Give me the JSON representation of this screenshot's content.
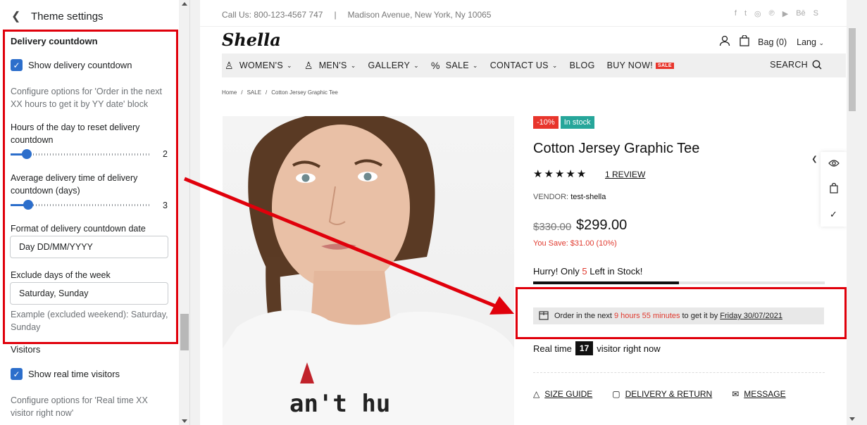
{
  "panel": {
    "title": "Theme settings",
    "delivery": {
      "section_title": "Delivery countdown",
      "show_label": "Show delivery countdown",
      "show_checked": true,
      "help": "Configure options for 'Order in the next XX hours to get it by YY date' block",
      "reset_label": "Hours of the day to reset delivery countdown",
      "reset_value": "2",
      "avg_label": "Average delivery time of delivery countdown (days)",
      "avg_value": "3",
      "format_label": "Format of delivery countdown date",
      "format_value": "Day DD/MM/YYYY",
      "exclude_label": "Exclude days of the week",
      "exclude_value": "Saturday, Sunday",
      "exclude_help": "Example (excluded weekend): Saturday, Sunday"
    },
    "visitors": {
      "section_title": "Visitors",
      "show_label": "Show real time visitors",
      "show_checked": true,
      "help": "Configure options for 'Real time XX visitor right now'"
    }
  },
  "store": {
    "call": "Call Us: 800-123-4567 747",
    "separator": "|",
    "address": "Madison Avenue, New York, Ny 10065",
    "social_icons": [
      "facebook-icon",
      "twitter-icon",
      "instagram-icon",
      "pinterest-icon",
      "youtube-icon",
      "behance-icon",
      "skype-icon"
    ],
    "social_glyphs": [
      "f",
      "t",
      "◎",
      "℗",
      "▶",
      "Bē",
      "S"
    ],
    "logo": "Shella",
    "bag": "Bag (0)",
    "lang": "Lang",
    "nav": [
      "WOMEN'S",
      "MEN'S",
      "GALLERY",
      "SALE",
      "CONTACT US",
      "BLOG",
      "BUY NOW!"
    ],
    "nav_sale_badge": "SALE",
    "search": "SEARCH",
    "breadcrumb": [
      "Home",
      "/",
      "SALE",
      "/",
      "Cotton Jersey Graphic Tee"
    ]
  },
  "product": {
    "discount": "-10%",
    "stock_badge": "In stock",
    "title": "Cotton Jersey Graphic Tee",
    "stars": "★★★★★",
    "rating": 5,
    "review": "1 REVIEW",
    "vendor_label": "VENDOR:",
    "vendor": "test-shella",
    "old_price": "$330.00",
    "price": "$299.00",
    "save": "You Save: $31.00 (10%)",
    "hurry_prefix": "Hurry! Only",
    "hurry_count": "5",
    "hurry_suffix": "Left in Stock!",
    "stock_fraction": 0.5,
    "delivery_prefix": "Order in the next",
    "delivery_time": "9 hours 55 minutes",
    "delivery_middle": "to get it by",
    "delivery_date": "Friday 30/07/2021",
    "realtime_prefix": "Real time",
    "realtime_count": "17",
    "realtime_suffix": "visitor right now",
    "links": [
      "SIZE GUIDE",
      "DELIVERY & RETURN",
      "MESSAGE"
    ]
  },
  "colors": {
    "accent_blue": "#2c6ecb",
    "annotation_red": "#e0000b",
    "discount_red": "#e8352c",
    "stock_green": "#26a69a"
  }
}
